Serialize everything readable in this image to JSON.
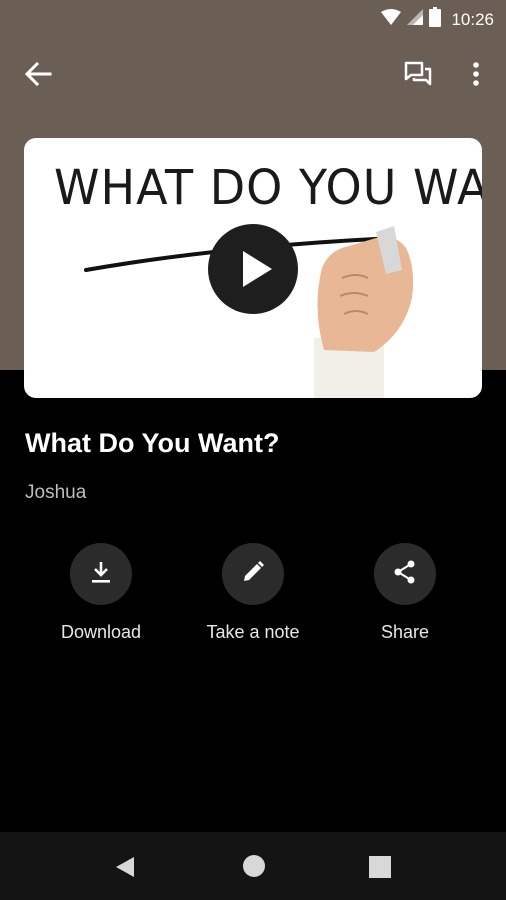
{
  "status_bar": {
    "time": "10:26",
    "icons": [
      "wifi-icon",
      "signal-icon",
      "battery-icon"
    ]
  },
  "app_bar": {
    "icons": [
      "back-arrow-icon",
      "chat-icon",
      "more-vert-icon"
    ]
  },
  "video": {
    "thumbnail_text": "WHAT DO YOU WANT ?",
    "title": "What Do You Want?",
    "author": "Joshua"
  },
  "actions": [
    {
      "label": "Download",
      "icon": "download-icon"
    },
    {
      "label": "Take a note",
      "icon": "pencil-icon"
    },
    {
      "label": "Share",
      "icon": "share-icon"
    }
  ],
  "nav_bar": {
    "icons": [
      "nav-back-icon",
      "nav-home-icon",
      "nav-recents-icon"
    ]
  },
  "colors": {
    "header_bg": "#6b5e55",
    "page_bg": "#000000",
    "button_circle": "#2b2b2b",
    "nav_bg": "#141414"
  }
}
